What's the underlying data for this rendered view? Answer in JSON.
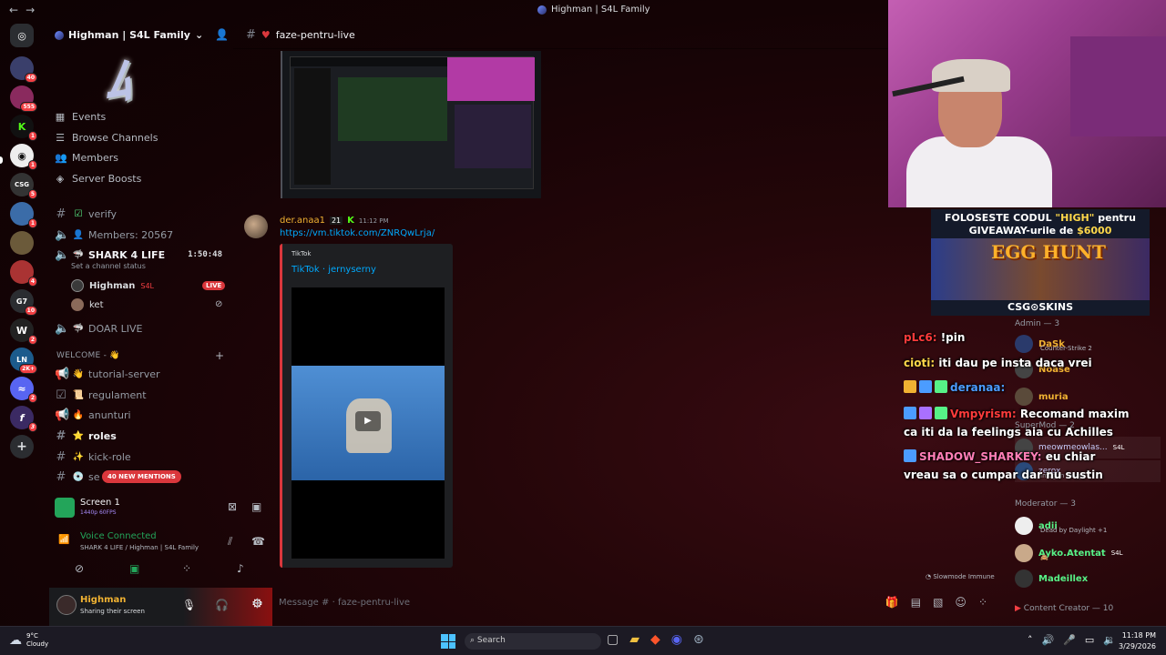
{
  "window": {
    "title": "Highman | S4L Family",
    "back": "←",
    "forward": "→"
  },
  "server": {
    "name": "Highman | S4L Family",
    "chevron": "⌄"
  },
  "guild_badges": [
    "40",
    "555",
    "1",
    "1",
    "5",
    "1",
    "4",
    "10",
    "2",
    "2K+",
    "2",
    "3"
  ],
  "server_menu": [
    {
      "icon": "calendar-icon",
      "label": "Events"
    },
    {
      "icon": "browse-icon",
      "label": "Browse Channels"
    },
    {
      "icon": "members-icon",
      "label": "Members"
    },
    {
      "icon": "boost-icon",
      "label": "Server Boosts"
    }
  ],
  "channels": {
    "verify": "verify",
    "members_count": "Members: 20567",
    "voice_shark": "SHARK 4 LIFE",
    "voice_timer": "1:50:48",
    "channel_status": "Set a channel status",
    "voice_users": [
      {
        "name": "Highman",
        "tag": "S4L",
        "live": "LIVE"
      },
      {
        "name": "ket"
      }
    ],
    "doar_live": "DOAR LIVE",
    "category_welcome": "WELCOME - 👋",
    "welcome_channels": [
      {
        "emoji": "👋",
        "name": "tutorial-server"
      },
      {
        "emoji": "📜",
        "name": "regulament"
      },
      {
        "emoji": "🔥",
        "name": "anunturi"
      },
      {
        "emoji": "⭐",
        "name": "roles",
        "active": true
      },
      {
        "emoji": "✨",
        "name": "kick-role"
      },
      {
        "emoji": "💿",
        "name": "se"
      }
    ],
    "new_mentions": "40 NEW MENTIONS"
  },
  "panel": {
    "screen_title": "Screen 1",
    "screen_quality": "1440p 60FPS",
    "voice_status": "Voice Connected",
    "voice_location": "SHARK 4 LIFE / Highman | S4L Family",
    "user_name": "Highman",
    "user_status": "Sharing their screen"
  },
  "topbar": {
    "channel": "faze-pentru-live"
  },
  "message": {
    "author": "der.anaa1",
    "badge_count": "21",
    "timestamp": "11:12 PM",
    "link": "https://vm.tiktok.com/ZNRQwLrja/",
    "embed_provider": "TikTok",
    "embed_title": "TikTok · jernyserny"
  },
  "slowmode": "Slowmode Immune",
  "composer": {
    "placeholder": "Message #  · faze-pentru-live"
  },
  "overlay": {
    "sponsor_line1a": "FOLOSESTE CODUL ",
    "sponsor_code": "\"HIGH\"",
    "sponsor_line1b": " pentru",
    "sponsor_line2a": "GIVEAWAY-urile de ",
    "sponsor_amount": "$6000",
    "sponsor_event": "EGG HUNT",
    "sponsor_brand": "CSG⊙SKINS"
  },
  "twitch_chat": [
    {
      "user": "pLc6:",
      "color": "#ff3b3b",
      "text": "!pin"
    },
    {
      "user": "cioti:",
      "color": "#ffd84a",
      "text": "iti dau pe insta daca vrei"
    },
    {
      "user": "deranaa:",
      "color": "#4b9cff",
      "text": ""
    },
    {
      "user": "Vmpyrism:",
      "color": "#ff3b3b",
      "text": "Recomand maxim"
    },
    {
      "user": "",
      "color": "#fff",
      "text": "ca iti da la feelings aia cu Achilles"
    },
    {
      "user": "SHADOW_SHARKEY:",
      "color": "#ff7eb6",
      "text": "eu chiar"
    },
    {
      "user": "",
      "color": "#fff",
      "text": "vreau sa o cumpar dar nu sustin"
    }
  ],
  "members": {
    "admin_header": "Admin — 3",
    "admins": [
      {
        "name": "DaSk",
        "color": "#f0b232",
        "status": "Counter-Strike 2"
      },
      {
        "name": "Noase",
        "color": "#f0b232",
        "status": ""
      },
      {
        "name": "muria",
        "color": "#f0b232",
        "status": ""
      }
    ],
    "supermod_header": "SuperMod — 2",
    "supermods": [
      {
        "name": "meowmeowlas...",
        "color": "#c9cdfb",
        "tag": "S4L",
        "status": ""
      },
      {
        "name": "zerox",
        "color": "#c9cdfb",
        "status": "Imogen Heap, C"
      }
    ],
    "mod_header": "Moderator — 3",
    "mods": [
      {
        "name": "adii",
        "color": "#57f287",
        "status": "Dead by Daylight +1"
      },
      {
        "name": "Ayko.Atentat",
        "color": "#57f287",
        "tag": "S4L",
        "status": "🙈"
      },
      {
        "name": "Madeillex",
        "color": "#57f287",
        "status": ""
      }
    ],
    "cc_header": "Content Creator — 10"
  },
  "taskbar": {
    "temp": "9°C",
    "weather": "Cloudy",
    "search": "Search",
    "time": "11:18 PM",
    "date": "3/29/2026"
  }
}
